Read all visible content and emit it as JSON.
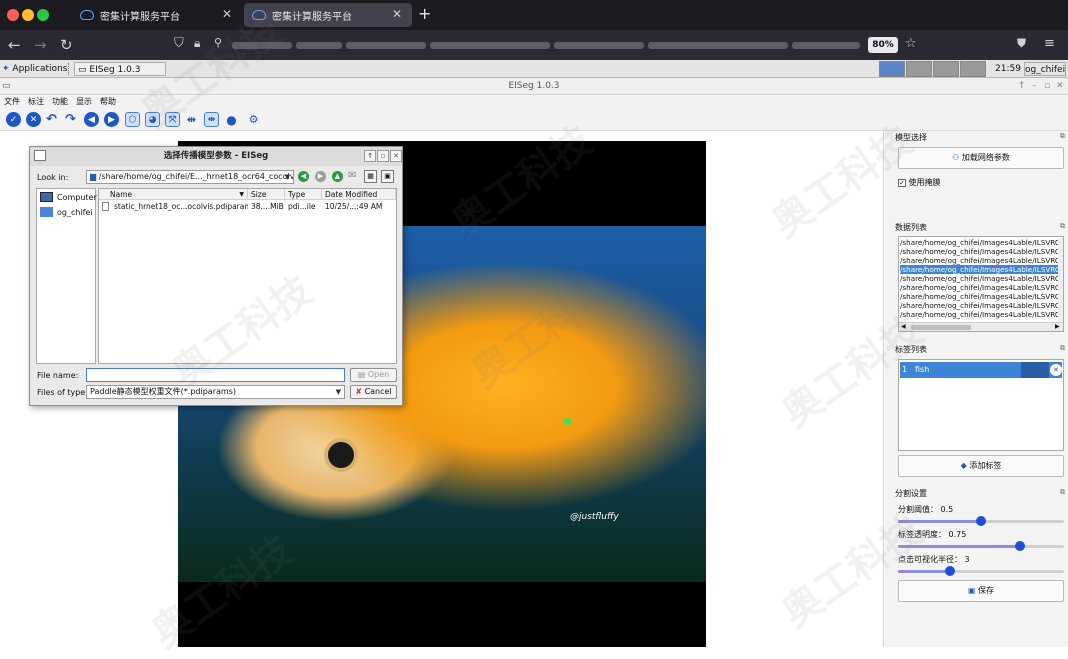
{
  "browser": {
    "tabs": [
      {
        "title": "密集计算服务平台",
        "active": false
      },
      {
        "title": "密集计算服务平台",
        "active": true
      }
    ],
    "zoom": "80%"
  },
  "desktop_panel": {
    "applications_label": "Applications",
    "taskbar_item": "EISeg 1.0.3",
    "clock": "21:59",
    "user": "og_chifei"
  },
  "app": {
    "window_title": "EISeg 1.0.3",
    "menu": [
      "文件",
      "标注",
      "功能",
      "显示",
      "帮助"
    ]
  },
  "image": {
    "watermark_text": "@justfluffy"
  },
  "dialog": {
    "title": "选择传播模型参数 - EISeg",
    "look_in_label": "Look in:",
    "look_in_value": "/share/home/og_chifei/E..._hrnet18_ocr64_cocolvis",
    "places": [
      "Computer",
      "og_chifei"
    ],
    "columns": [
      "Name",
      "Size",
      "Type",
      "Date Modified"
    ],
    "files": [
      {
        "name": "static_hrnet18_oc...ocolvis.pdiparams",
        "size": "38....MiB",
        "type": "pdi...ile",
        "modified": "10/25/...:49 AM"
      }
    ],
    "file_name_label": "File name:",
    "file_name_value": "",
    "file_type_label": "Files of type:",
    "file_type_value": "Paddle静态模型权重文件(*.pdiparams)",
    "open_button": "Open",
    "cancel_button": "Cancel"
  },
  "right_panel": {
    "model_section": {
      "title": "模型选择",
      "load_button": "加载网络参数",
      "use_mask_checkbox": "使用掩膜",
      "use_mask_checked": true
    },
    "data_section": {
      "title": "数据列表",
      "items": [
        "/share/home/og_chifei/Images4Lable/ILSVRC",
        "/share/home/og_chifei/Images4Lable/ILSVRC",
        "/share/home/og_chifei/Images4Lable/ILSVRC",
        "/share/home/og_chifei/Images4Lable/ILSVRC",
        "/share/home/og_chifei/Images4Lable/ILSVRC",
        "/share/home/og_chifei/Images4Lable/ILSVRC",
        "/share/home/og_chifei/Images4Lable/ILSVRC",
        "/share/home/og_chifei/Images4Lable/ILSVRC",
        "/share/home/og_chifei/Images4Lable/ILSVRC",
        "/share/home/og_chifei/Images4Lable/ILSVRC"
      ],
      "selected_index": 3
    },
    "label_section": {
      "title": "标签列表",
      "labels": [
        {
          "id": "1",
          "name": "fish",
          "color": "#2a5fa8"
        }
      ],
      "add_button": "添加标签"
    },
    "seg_section": {
      "title": "分割设置",
      "threshold_label": "分割阈值：",
      "threshold_value": "0.5",
      "threshold_fraction": 0.5,
      "opacity_label": "标签透明度：",
      "opacity_value": "0.75",
      "opacity_fraction": 0.75,
      "radius_label": "点击可视化半径：",
      "radius_value": "3",
      "radius_fraction": 0.3,
      "save_button": "保存"
    }
  },
  "watermarks": [
    "奥工科技",
    "奥工科技",
    "奥工科技",
    "奥工科技",
    "奥工科技",
    "奥工科技",
    "奥工科技",
    "奥工科技"
  ]
}
